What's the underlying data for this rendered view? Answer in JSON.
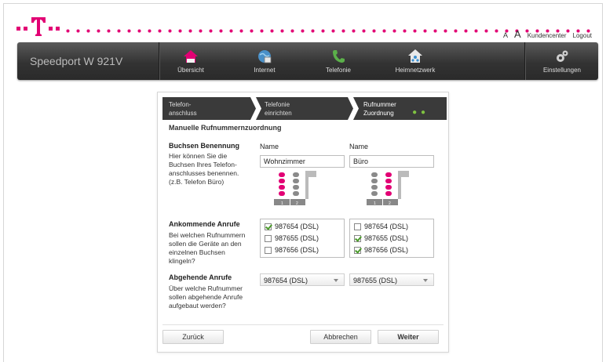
{
  "header": {
    "font_small": "A",
    "font_big": "A",
    "kundencenter": "Kundencenter",
    "logout": "Logout",
    "brand_color": "#e20074"
  },
  "nav": {
    "product": "Speedport W 921V",
    "items": [
      {
        "label": "Übersicht",
        "icon": "home-icon"
      },
      {
        "label": "Internet",
        "icon": "globe-icon"
      },
      {
        "label": "Telefonie",
        "icon": "phone-icon"
      },
      {
        "label": "Heimnetzwerk",
        "icon": "network-home-icon"
      },
      {
        "label": "Einstellungen",
        "icon": "gear-icon"
      }
    ]
  },
  "steps": [
    {
      "line1": "Telefon-",
      "line2": "anschluss"
    },
    {
      "line1": "Telefonie",
      "line2": "einrichten"
    },
    {
      "line1": "Rufnummer",
      "line2": "Zuordnung"
    }
  ],
  "step_dots": "● ●",
  "page_title": "Manuelle Rufnummernzuordnung",
  "buchsen": {
    "heading": "Buchsen Benennung",
    "desc_lines": [
      "Hier können Sie die",
      "Buchsen Ihres Telefon-",
      "anschlusses benennen.",
      "(z.B. Telefon Büro)"
    ],
    "col1_head": "Name",
    "col2_head": "Name",
    "col1_value": "Wohnzimmer",
    "col2_value": "Büro",
    "socket_labels": [
      "1",
      "2"
    ]
  },
  "ankommende": {
    "heading": "Ankommende Anrufe",
    "desc_lines": [
      "Bei welchen Rufnummern",
      "sollen die Geräte an den",
      "einzelnen Buchsen",
      "klingeln?"
    ],
    "col1": [
      {
        "label": "987654 (DSL)",
        "checked": true
      },
      {
        "label": "987655 (DSL)",
        "checked": false
      },
      {
        "label": "987656 (DSL)",
        "checked": false
      }
    ],
    "col2": [
      {
        "label": "987654 (DSL)",
        "checked": false
      },
      {
        "label": "987655 (DSL)",
        "checked": true
      },
      {
        "label": "987656 (DSL)",
        "checked": true
      }
    ]
  },
  "abgehende": {
    "heading": "Abgehende Anrufe",
    "desc_lines": [
      "Über welche Rufnummer",
      "sollen abgehende Anrufe",
      "aufgebaut werden?"
    ],
    "col1_selected": "987654 (DSL)",
    "col2_selected": "987655 (DSL)"
  },
  "buttons": {
    "back": "Zurück",
    "cancel": "Abbrechen",
    "next": "Weiter"
  }
}
